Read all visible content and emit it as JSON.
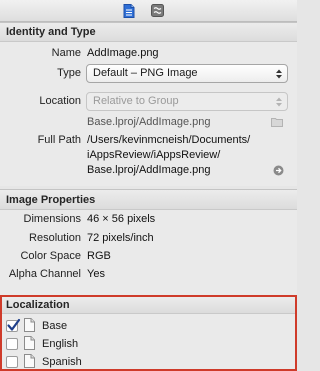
{
  "toolbar": {
    "tabs": [
      {
        "icon": "file-inspector-icon",
        "selected": true
      },
      {
        "icon": "quick-help-icon",
        "selected": false
      }
    ]
  },
  "identity": {
    "title": "Identity and Type",
    "name_label": "Name",
    "name_value": "AddImage.png",
    "type_label": "Type",
    "type_value": "Default – PNG Image",
    "location_label": "Location",
    "location_value": "Relative to Group",
    "location_path": "Base.lproj/AddImage.png",
    "full_path_label": "Full Path",
    "full_path_lines": [
      "/Users/kevinmcneish/Documents/",
      "iAppsReview/iAppsReview/",
      "Base.lproj/AddImage.png"
    ]
  },
  "image_properties": {
    "title": "Image Properties",
    "dimensions_label": "Dimensions",
    "dimensions_value": "46 × 56 pixels",
    "resolution_label": "Resolution",
    "resolution_value": "72 pixels/inch",
    "color_space_label": "Color Space",
    "color_space_value": "RGB",
    "alpha_label": "Alpha Channel",
    "alpha_value": "Yes"
  },
  "localization": {
    "title": "Localization",
    "highlight_color": "#cf3b2a",
    "items": [
      {
        "label": "Base",
        "checked": true
      },
      {
        "label": "English",
        "checked": false
      },
      {
        "label": "Spanish",
        "checked": false
      }
    ]
  }
}
